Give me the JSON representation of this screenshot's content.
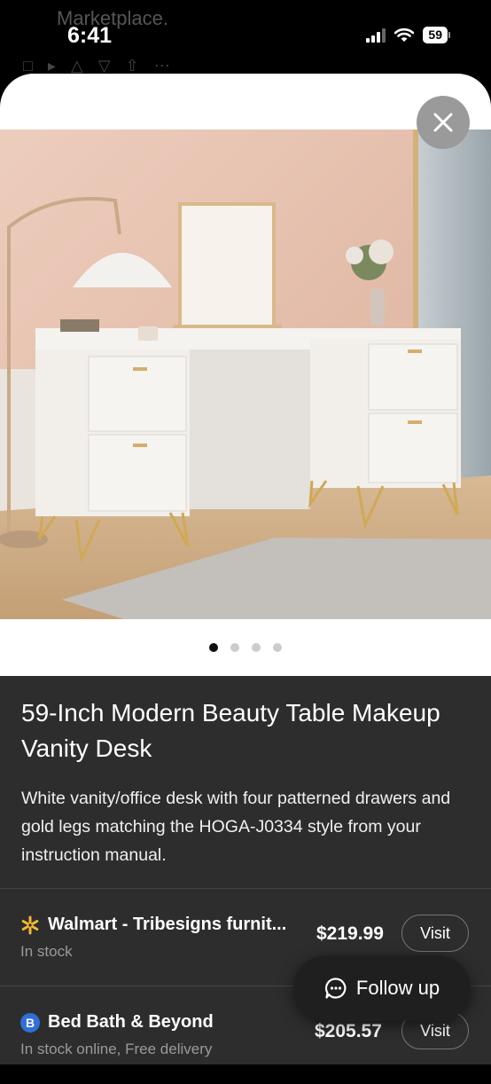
{
  "status_bar": {
    "behind_title": "Marketplace.",
    "time": "6:41",
    "battery": "59"
  },
  "gallery": {
    "image_alt": "White vanity desk with lighted mirror and gold legs",
    "slide_count": 4,
    "active_slide": 1
  },
  "product": {
    "title": "59-Inch Modern Beauty Table Makeup Vanity Desk",
    "description": "White vanity/office desk with four patterned drawers and gold legs matching the HOGA-J0334 style from your instruction manual."
  },
  "listings": [
    {
      "store": "Walmart - Tribesigns furnit...",
      "availability": "In stock",
      "price": "$219.99",
      "visit_label": "Visit",
      "icon": "walmart-spark-icon"
    },
    {
      "store": "Bed Bath & Beyond",
      "availability": "In stock online, Free delivery",
      "price": "$205.57",
      "visit_label": "Visit",
      "icon": "bed-bath-beyond-icon",
      "icon_letter": "B"
    }
  ],
  "follow_up": {
    "label": "Follow up",
    "icon": "chat-bubble-icon"
  },
  "colors": {
    "panel": "#2d2d2d",
    "walmart_yellow": "#f5b82e",
    "bbb_blue": "#2f6fd6"
  }
}
